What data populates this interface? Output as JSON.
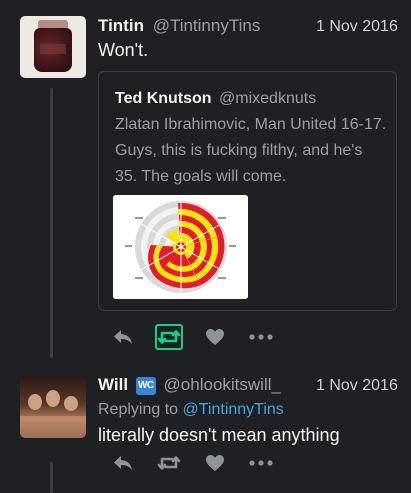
{
  "tweets": [
    {
      "name": "Tintin",
      "handle": "@TintinnyTins",
      "date": "1 Nov 2016",
      "text": "Won't.",
      "quoted": {
        "name": "Ted Knutson",
        "handle": "@mixedknuts",
        "text": "Zlatan Ibrahimovic, Man United 16-17. Guys, this is fucking filthy, and he's 35. The goals will come."
      },
      "retweeted": true
    },
    {
      "name": "Will",
      "badge": "WC",
      "handle": "@ohlookitswill_",
      "date": "1 Nov 2016",
      "replying_prefix": "Replying to",
      "replying_to": "@TintinnyTins",
      "text": "literally doesn't mean anything",
      "retweeted": false
    }
  ],
  "icons": {
    "reply": "reply-icon",
    "retweet": "retweet-icon",
    "like": "heart-icon",
    "more": "more-icon"
  },
  "colors": {
    "background": "#1e2024",
    "retweet_active": "#19cf86",
    "action_gray": "#8f949a",
    "mention": "#4aa3df",
    "radar_fill_a": "#e01e2b",
    "radar_fill_b": "#f4e21b"
  }
}
